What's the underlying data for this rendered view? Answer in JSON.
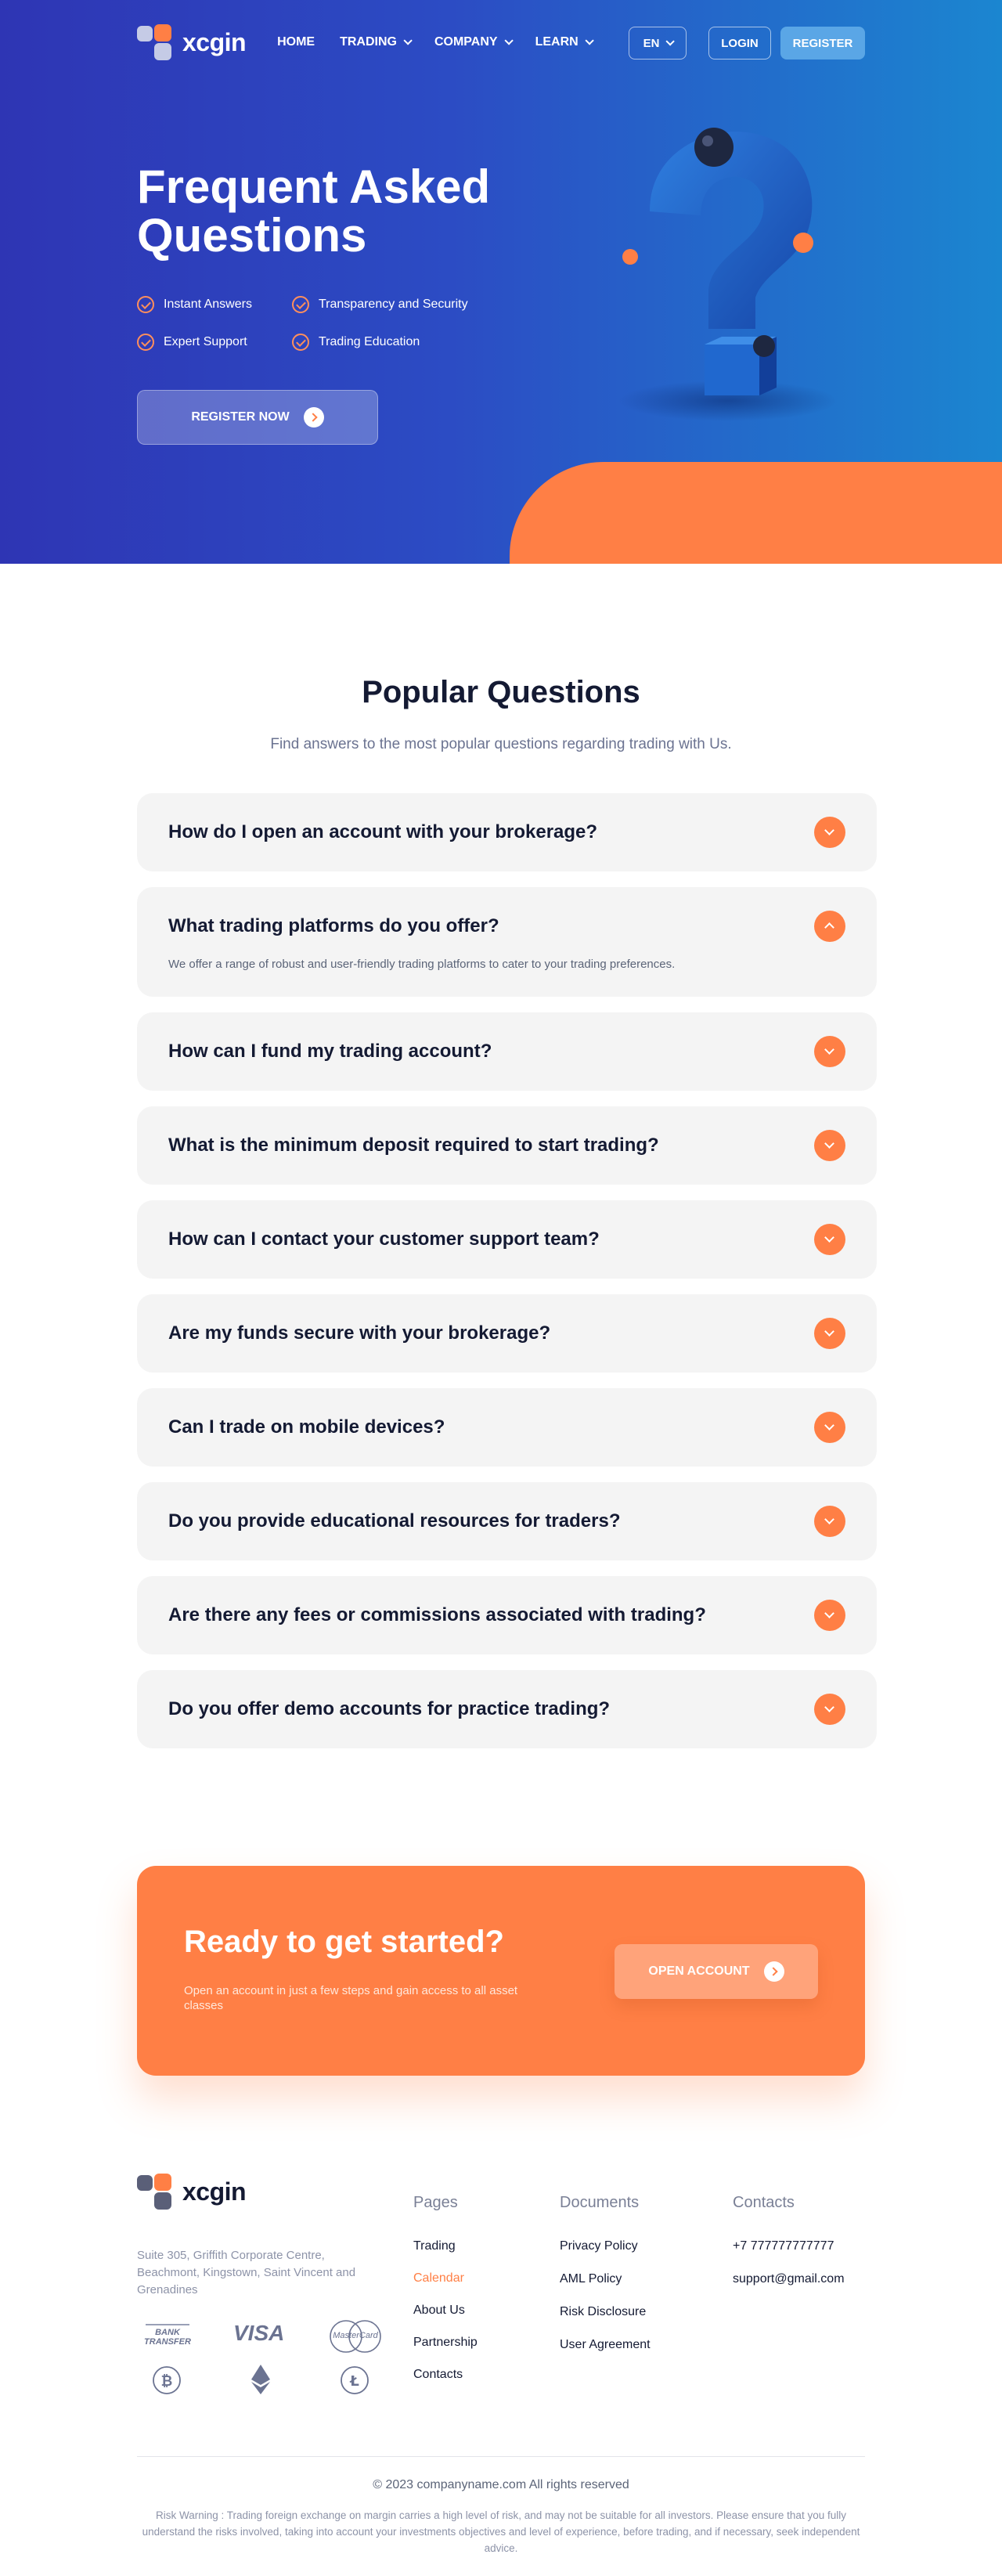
{
  "brand": {
    "name": "xcgin"
  },
  "nav": {
    "links": [
      "HOME",
      "TRADING",
      "COMPANY",
      "LEARN"
    ],
    "lang": "EN",
    "login": "LOGIN",
    "register": "REGISTER"
  },
  "hero": {
    "title": "Frequent Asked Questions",
    "features": [
      "Instant Answers",
      "Transparency and Security",
      "Expert Support",
      "Trading Education"
    ],
    "cta": "REGISTER NOW"
  },
  "faq": {
    "title": "Popular Questions",
    "subtitle": "Find answers to the most popular questions regarding trading with Us.",
    "items": [
      {
        "q": "How do I open an account with your brokerage?",
        "a": "",
        "open": false
      },
      {
        "q": "What trading platforms do you offer?",
        "a": "We offer a range of robust and user-friendly trading platforms to cater to your trading preferences.",
        "open": true
      },
      {
        "q": "How can I fund my trading account?",
        "a": "",
        "open": false
      },
      {
        "q": "What is the minimum deposit required to start trading?",
        "a": "",
        "open": false
      },
      {
        "q": "How can I contact your customer support team?",
        "a": "",
        "open": false
      },
      {
        "q": "Are my funds secure with your brokerage?",
        "a": "",
        "open": false
      },
      {
        "q": "Can I trade on mobile devices?",
        "a": "",
        "open": false
      },
      {
        "q": "Do you provide educational resources for traders?",
        "a": "",
        "open": false
      },
      {
        "q": "Are there any fees or commissions associated with trading?",
        "a": "",
        "open": false
      },
      {
        "q": "Do you offer demo accounts for practice trading?",
        "a": "",
        "open": false
      }
    ]
  },
  "cta": {
    "title": "Ready to get started?",
    "text": "Open an account in just a few steps and gain access to all asset classes",
    "button": "OPEN ACCOUNT"
  },
  "footer": {
    "address": "Suite 305, Griffith Corporate Centre, Beachmont, Kingstown, Saint Vincent and Grenadines",
    "payments": {
      "bank": "BANK TRANSFER",
      "visa": "VISA",
      "mastercard": "MasterCard"
    },
    "pages_title": "Pages",
    "pages": [
      "Trading",
      "Calendar",
      "About Us",
      "Partnership",
      "Contacts"
    ],
    "active_page": "Calendar",
    "documents_title": "Documents",
    "documents": [
      "Privacy Policy",
      "AML Policy",
      "Risk Disclosure",
      "User Agreement"
    ],
    "contacts_title": "Contacts",
    "contacts": [
      "+7 777777777777",
      "support@gmail.com"
    ],
    "copyright": "© 2023 companyname.com All rights reserved",
    "risk": "Risk Warning : Trading foreign exchange on margin carries a high level of risk, and may not be suitable for all investors. Please ensure that you fully understand the risks involved, taking into account your investments objectives and level of experience, before trading, and if necessary, seek independent advice."
  },
  "colors": {
    "accent": "#ff7f45",
    "hero_start": "#2e35b4",
    "hero_end": "#1b86d0",
    "text_dark": "#141a33"
  }
}
